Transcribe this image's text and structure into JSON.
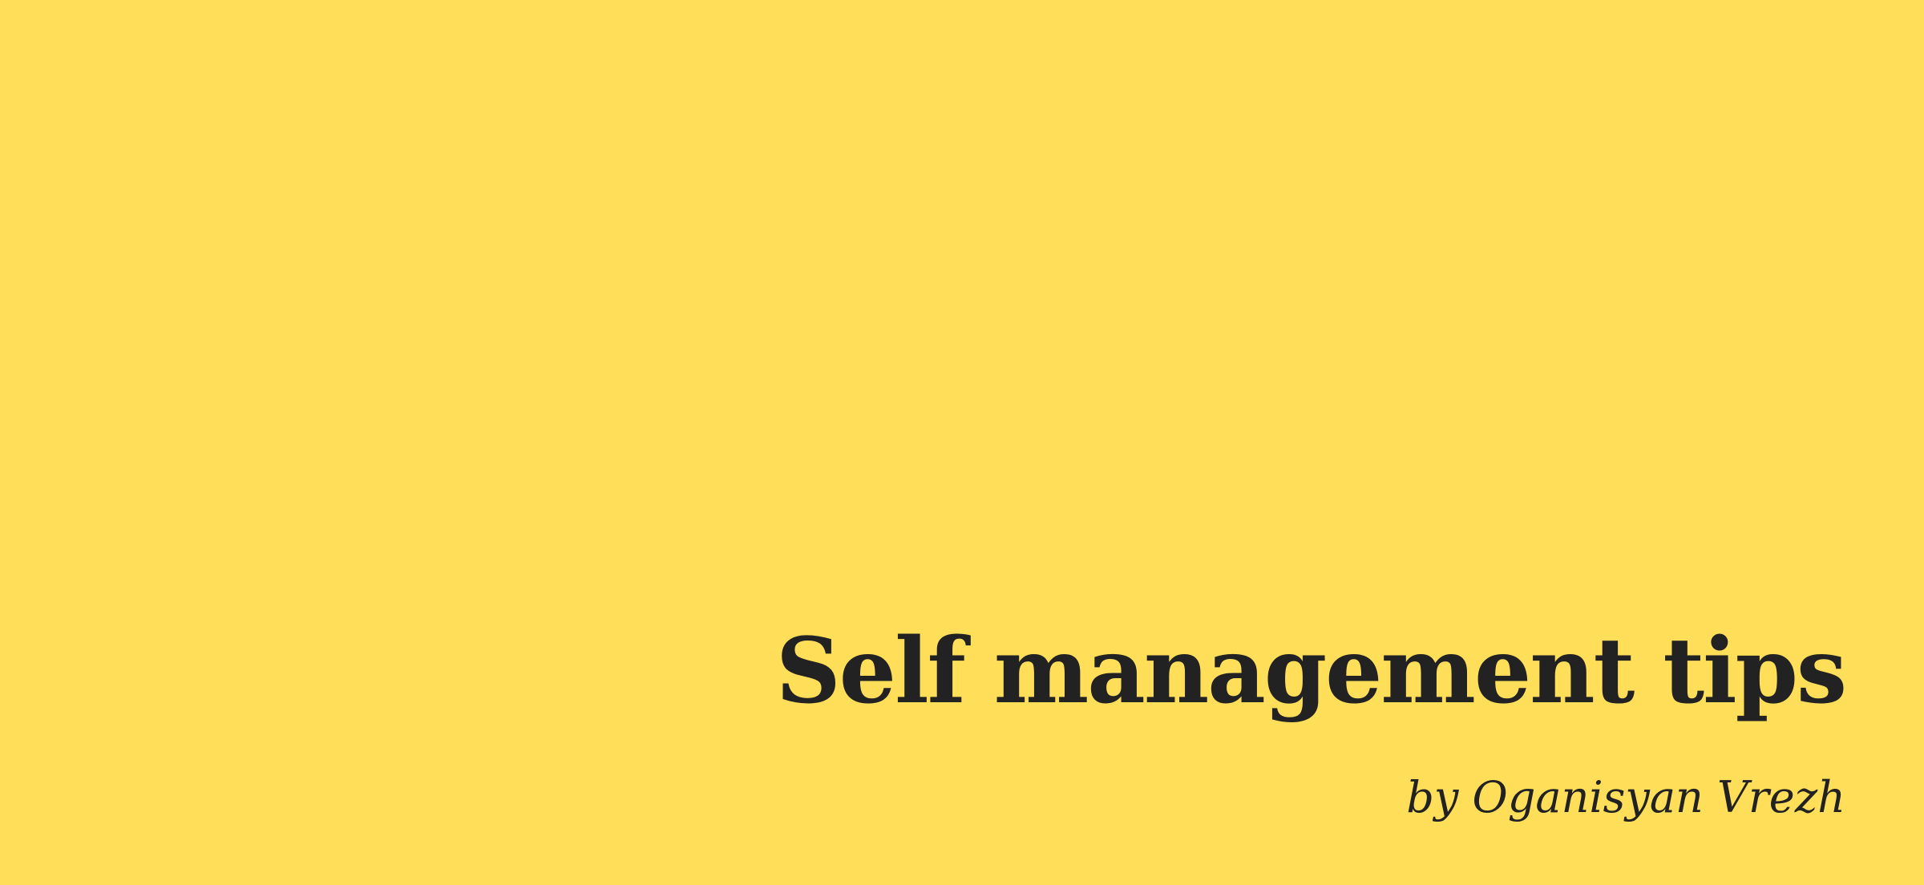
{
  "colors": {
    "background": "#FFDE59",
    "text": "#222222"
  },
  "slide": {
    "title": "Self management tips",
    "byline": "by Oganisyan Vrezh"
  }
}
